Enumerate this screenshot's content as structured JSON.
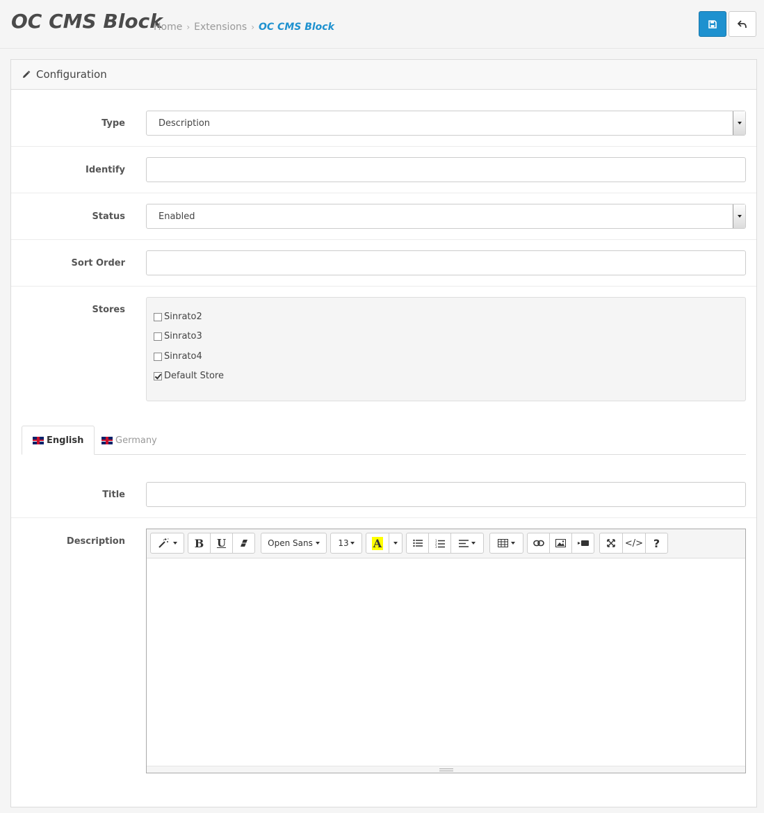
{
  "header": {
    "title": "OC CMS Block",
    "breadcrumb": [
      "Home",
      "Extensions",
      "OC CMS Block"
    ],
    "save_icon": "save-icon",
    "back_icon": "reply-icon"
  },
  "panel": {
    "heading": "Configuration",
    "heading_icon": "pencil-icon"
  },
  "form": {
    "type": {
      "label": "Type",
      "value": "Description"
    },
    "identify": {
      "label": "Identify",
      "value": ""
    },
    "status": {
      "label": "Status",
      "value": "Enabled"
    },
    "sort_order": {
      "label": "Sort Order",
      "value": ""
    },
    "stores": {
      "label": "Stores",
      "items": [
        {
          "name": "Sinrato2",
          "checked": false
        },
        {
          "name": "Sinrato3",
          "checked": false
        },
        {
          "name": "Sinrato4",
          "checked": false
        },
        {
          "name": "Default Store",
          "checked": true
        }
      ]
    }
  },
  "tabs": [
    {
      "label": "English",
      "active": true,
      "flag_icon": "uk-flag-icon"
    },
    {
      "label": "Germany",
      "active": false,
      "flag_icon": "uk-flag-icon"
    }
  ],
  "language": {
    "title": {
      "label": "Title",
      "value": ""
    },
    "description": {
      "label": "Description",
      "value": ""
    }
  },
  "editor_toolbar": {
    "font_family": "Open Sans",
    "font_size": "13",
    "highlight_color": "#ffff00",
    "icons": [
      "magic-icon",
      "bold-icon",
      "underline-icon",
      "eraser-icon",
      "highlight-icon",
      "unordered-list-icon",
      "ordered-list-icon",
      "align-icon",
      "table-icon",
      "link-icon",
      "image-icon",
      "video-icon",
      "fullscreen-icon",
      "code-icon",
      "help-icon"
    ]
  },
  "colors": {
    "accent": "#1e91cf"
  }
}
